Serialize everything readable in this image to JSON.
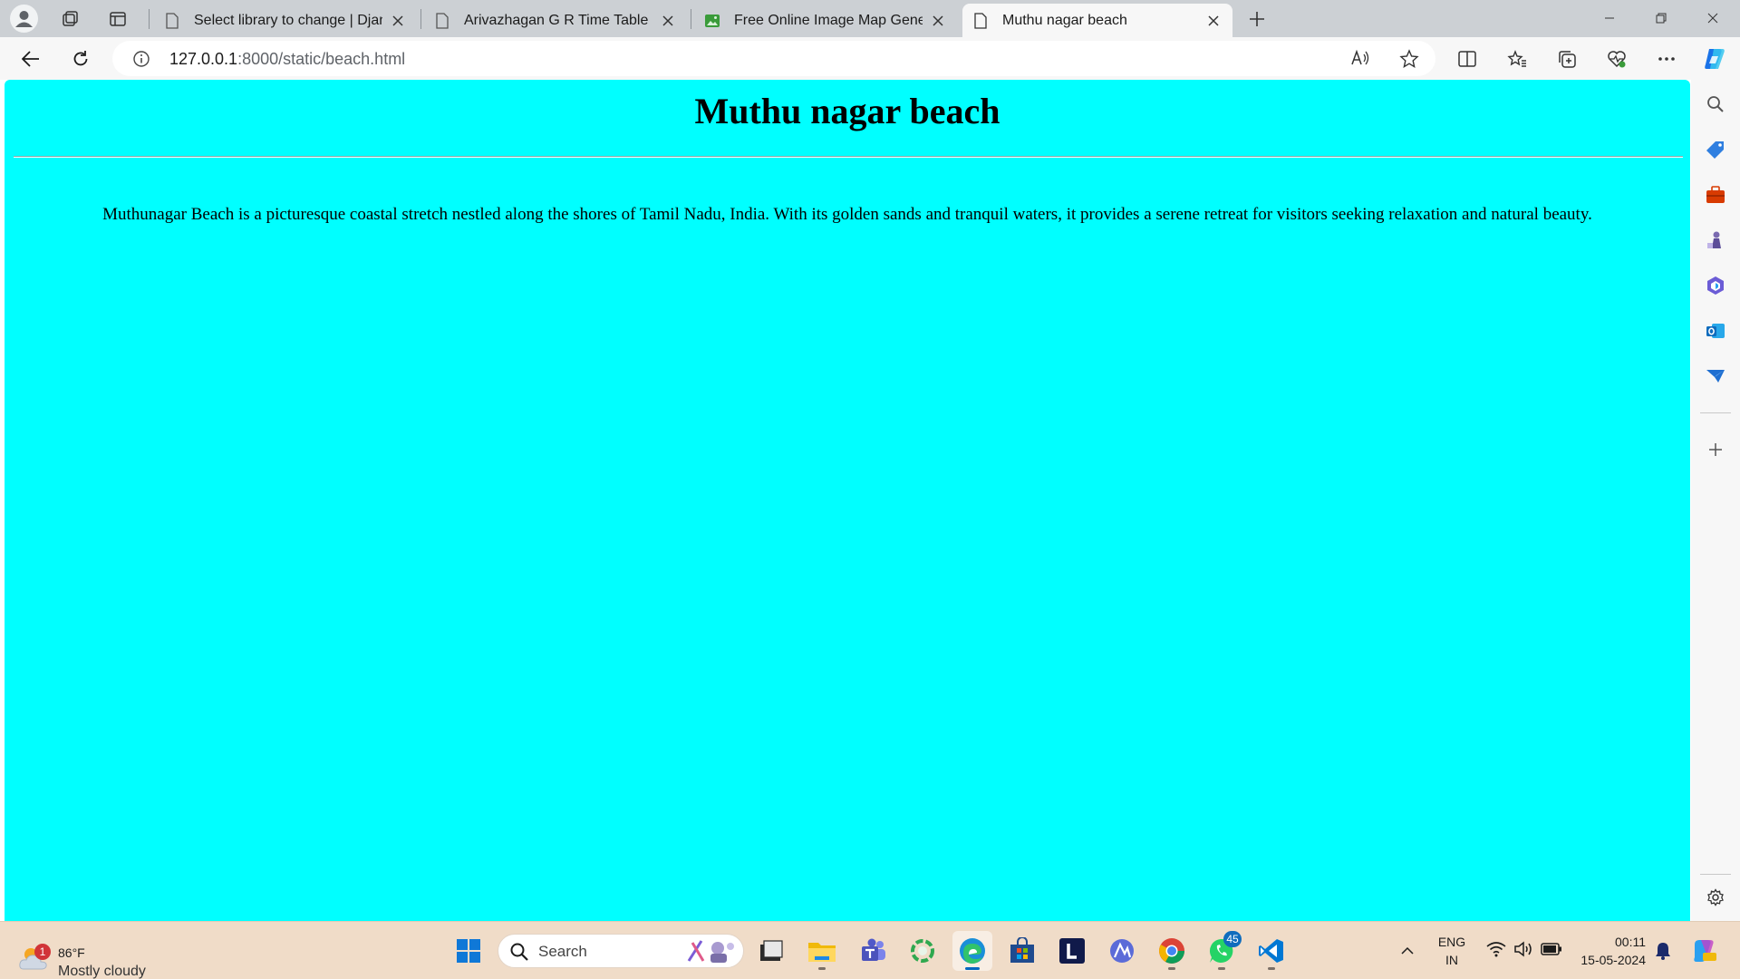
{
  "browser": {
    "tabs": [
      {
        "title": "Select library to change | Django",
        "icon": "page-icon"
      },
      {
        "title": "Arivazhagan G R Time Table",
        "icon": "page-icon"
      },
      {
        "title": "Free Online Image Map Generator",
        "icon": "image-icon"
      },
      {
        "title": "Muthu nagar beach",
        "icon": "page-icon",
        "active": true
      }
    ],
    "address": {
      "host": "127.0.0.1",
      "path": ":8000/static/beach.html"
    }
  },
  "page": {
    "heading": "Muthu nagar beach",
    "paragraph": "Muthunagar Beach is a picturesque coastal stretch nestled along the shores of Tamil Nadu, India. With its golden sands and tranquil waters, it provides a serene retreat for visitors seeking relaxation and natural beauty.",
    "background": "#00ffff"
  },
  "taskbar": {
    "weather": {
      "temperature": "86°F",
      "condition": "Mostly cloudy",
      "badge": "1"
    },
    "search_label": "Search",
    "whatsapp_badge": "45",
    "language": {
      "line1": "ENG",
      "line2": "IN"
    },
    "clock": {
      "time": "00:11",
      "date": "15-05-2024"
    }
  }
}
